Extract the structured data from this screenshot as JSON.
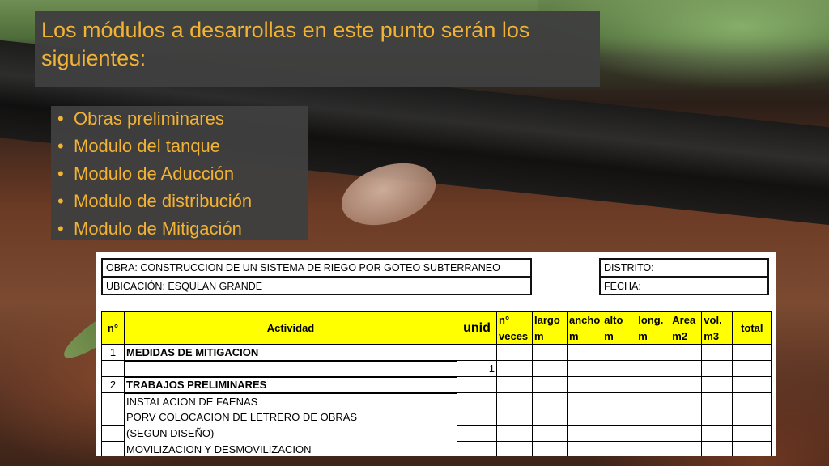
{
  "title": "Los módulos a desarrollas en este punto serán los siguientes:",
  "bullets": [
    "Obras preliminares",
    "Modulo del tanque",
    "Modulo de Aducción",
    "Modulo de distribución",
    "Modulo de Mitigación"
  ],
  "sheet": {
    "obra": "OBRA: CONSTRUCCION DE UN SISTEMA DE RIEGO POR GOTEO SUBTERRANEO",
    "ubicacion": "UBICACIÓN: ESQULAN GRANDE",
    "distrito": "DISTRITO:",
    "fecha": "FECHA:",
    "headers": {
      "n": "n°",
      "actividad": "Actividad",
      "unid": "unid",
      "n_top": "n°",
      "n_bottom": "veces",
      "largo_top": "largo",
      "largo_bottom": "m",
      "ancho_top": "ancho",
      "ancho_bottom": "m",
      "alto_top": "alto",
      "alto_bottom": "m",
      "long_top": "long.",
      "long_bottom": "m",
      "area_top": "Area",
      "area_bottom": "m2",
      "vol_top": "vol.",
      "vol_bottom": "m3",
      "total": "total"
    },
    "rows": [
      {
        "n": "1",
        "actividad": "MEDIDAS DE MITIGACION",
        "veces": ""
      },
      {
        "n": "",
        "actividad": "",
        "veces": "1"
      },
      {
        "n": "2",
        "actividad": "TRABAJOS PRELIMINARES",
        "veces": ""
      },
      {
        "n": "",
        "actividad": "INSTALACION DE FAENAS",
        "veces": ""
      },
      {
        "n": "",
        "actividad": "PORV COLOCACION DE LETRERO DE OBRAS",
        "veces": ""
      },
      {
        "n": "",
        "actividad": "(SEGUN DISEÑO)",
        "veces": ""
      },
      {
        "n": "",
        "actividad": "MOVILIZACION Y DESMOVILIZACION",
        "veces": ""
      }
    ]
  },
  "colors": {
    "title_text": "#f2b233",
    "box_bg": "#404040",
    "header_yellow": "#ffff00"
  }
}
